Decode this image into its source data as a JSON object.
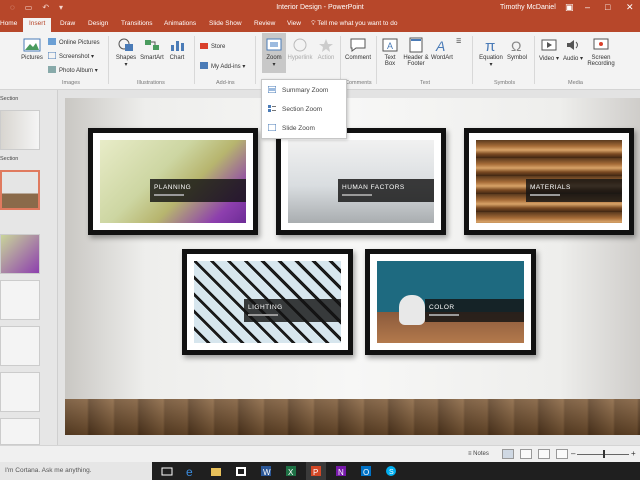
{
  "titlebar": {
    "title": "Interior Design - PowerPoint",
    "user": "Timothy McDaniel"
  },
  "tabs": [
    "Home",
    "Insert",
    "Draw",
    "Design",
    "Transitions",
    "Animations",
    "Slide Show",
    "Review",
    "View"
  ],
  "tellme": "Tell me what you want to do",
  "ribbon": {
    "pictures": "Pictures",
    "online_pictures": "Online Pictures",
    "screenshot": "Screenshot",
    "photo_album": "Photo Album",
    "images_group": "Images",
    "shapes": "Shapes",
    "smartart": "SmartArt",
    "chart": "Chart",
    "illustrations_group": "Illustrations",
    "store": "Store",
    "my_addins": "My Add-ins",
    "addins_group": "Add-ins",
    "zoom": "Zoom",
    "hyperlink": "Hyperlink",
    "action": "Action",
    "comment": "Comment",
    "comments_group": "Comments",
    "textbox": "Text Box",
    "header_footer": "Header & Footer",
    "wordart": "WordArt",
    "text_group": "Text",
    "equation": "Equation",
    "symbol": "Symbol",
    "symbols_group": "Symbols",
    "video": "Video",
    "audio": "Audio",
    "screen_recording": "Screen Recording",
    "media_group": "Media"
  },
  "zoom_menu": [
    "Summary Zoom",
    "Section Zoom",
    "Slide Zoom"
  ],
  "thumbs": {
    "section1": "Section",
    "section2": "Section"
  },
  "slide": {
    "frames": [
      {
        "title": "PLANNING"
      },
      {
        "title": "HUMAN FACTORS"
      },
      {
        "title": "MATERIALS"
      },
      {
        "title": "LIGHTING"
      },
      {
        "title": "COLOR"
      }
    ]
  },
  "status": {
    "notes": "Notes"
  },
  "taskbar": {
    "cortana": "I'm Cortana. Ask me anything."
  }
}
